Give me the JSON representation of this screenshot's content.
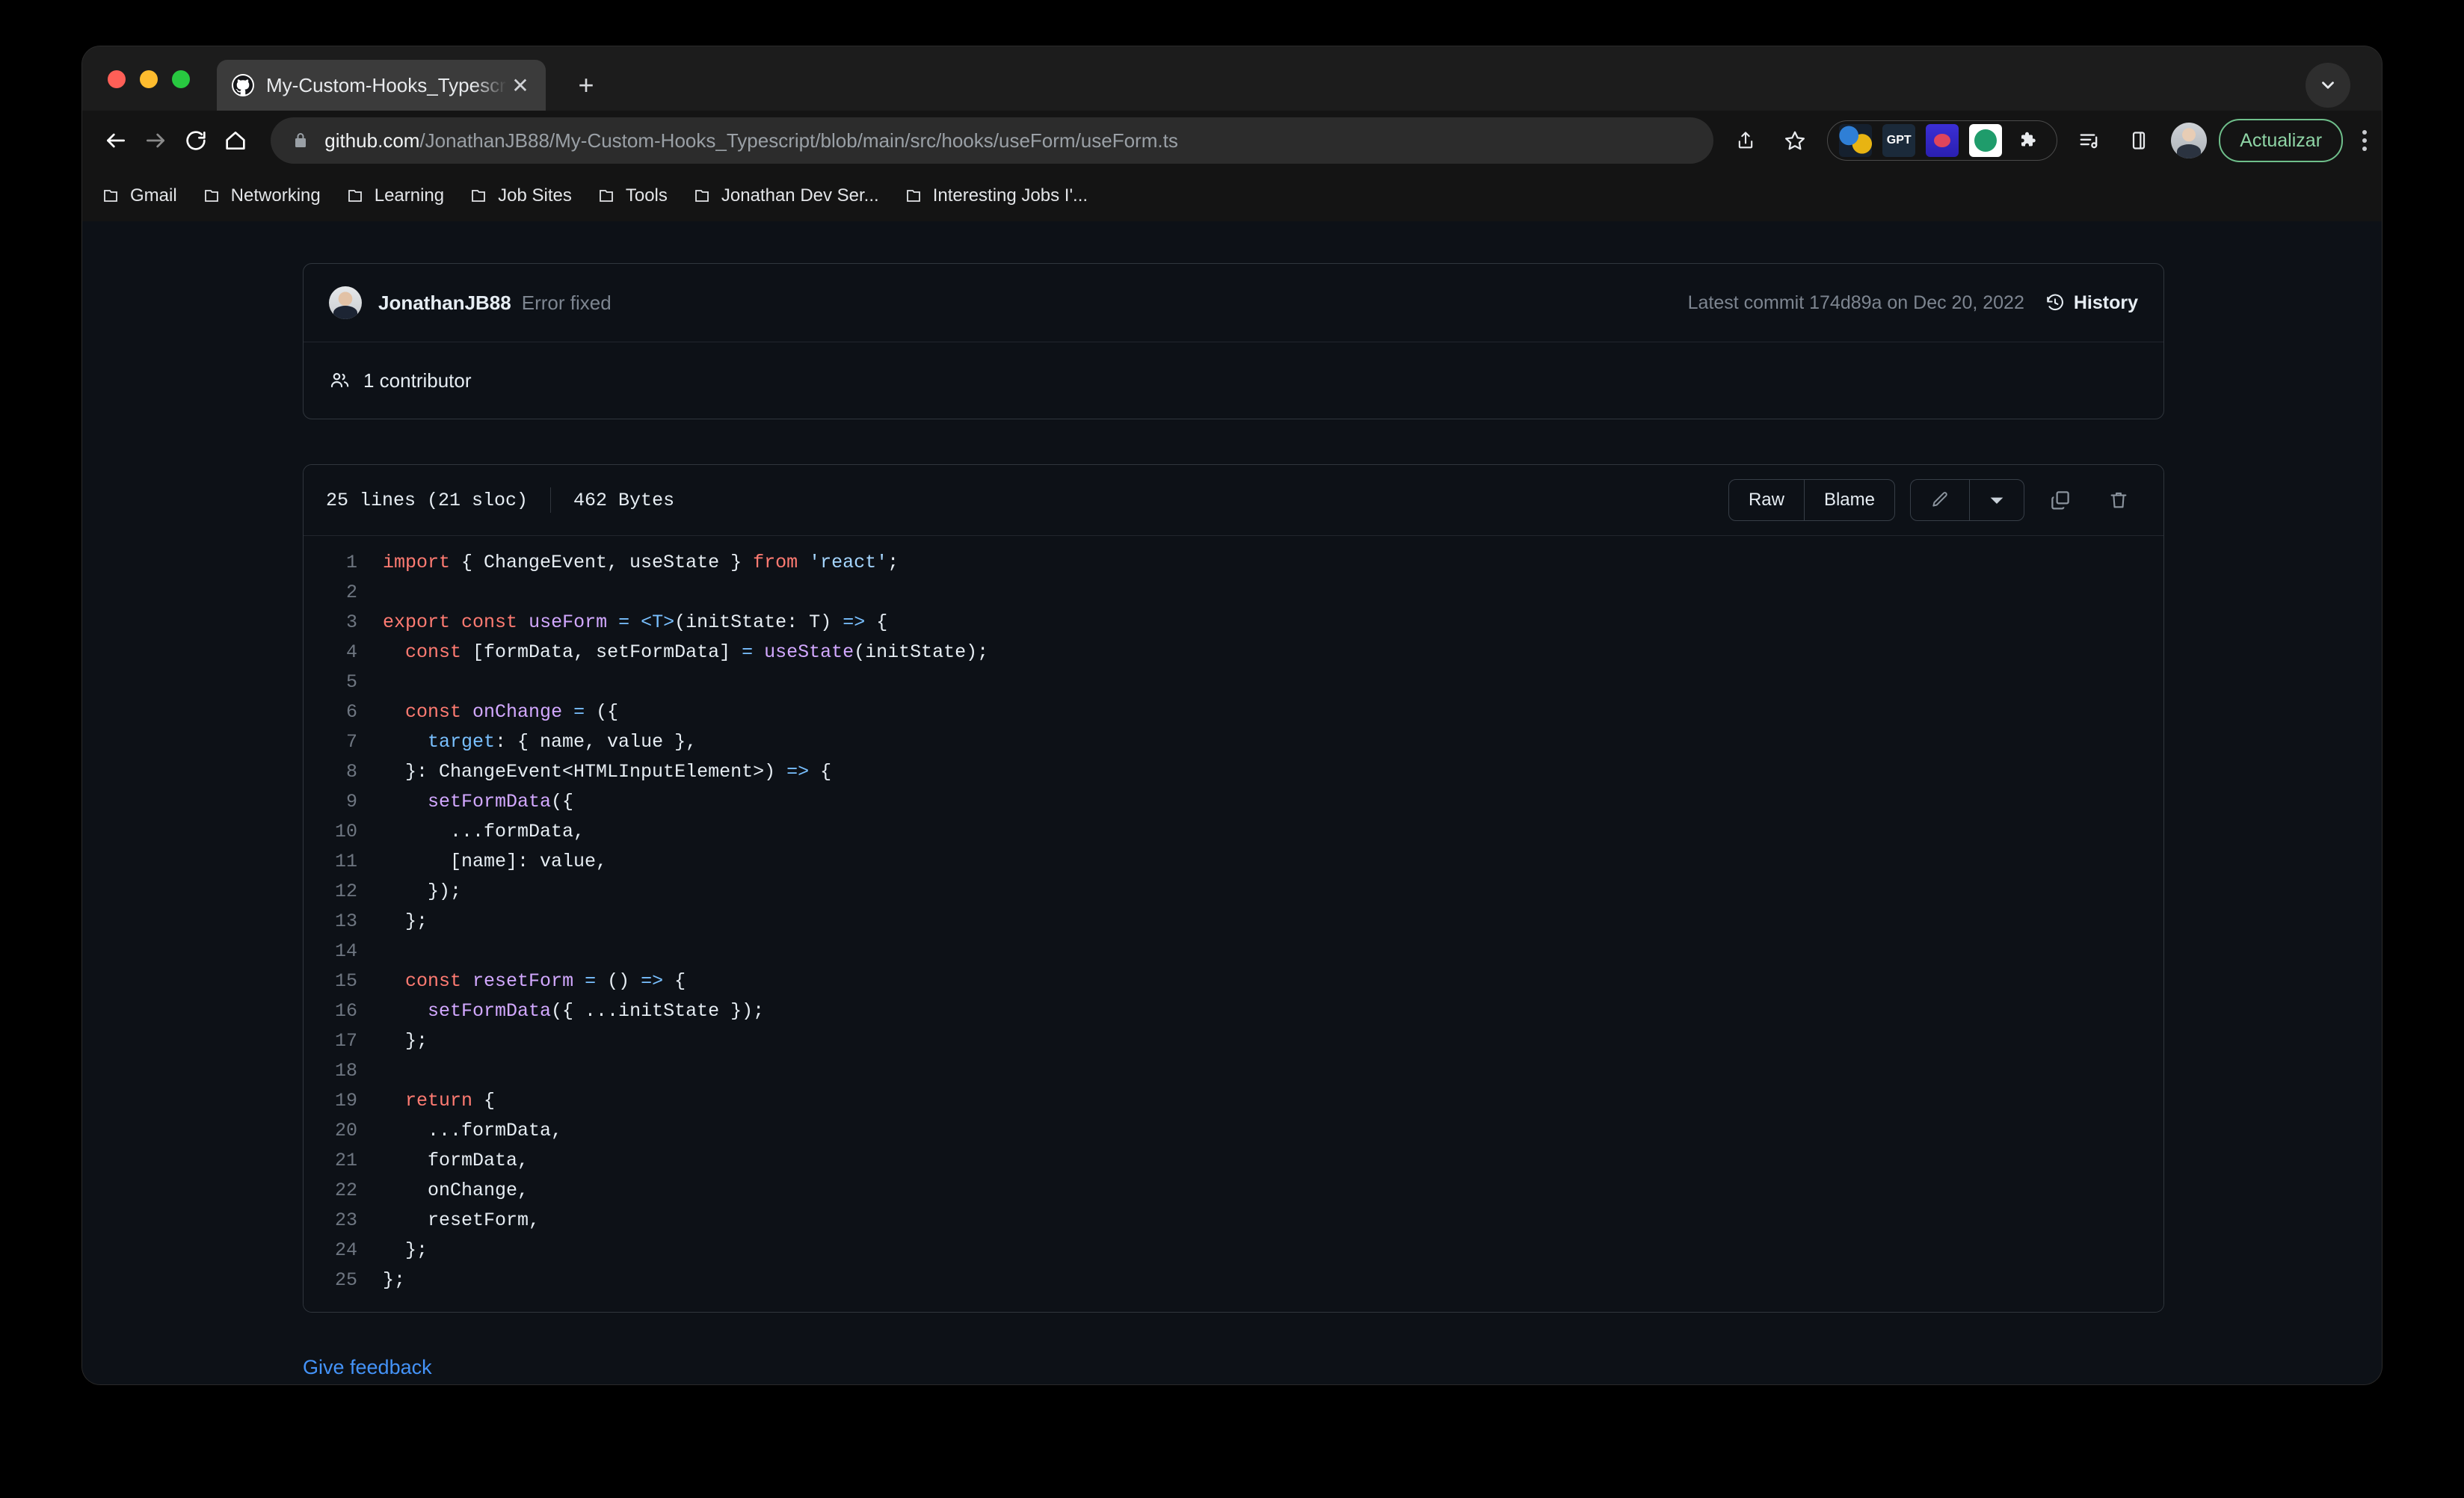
{
  "browser": {
    "tab": {
      "title": "My-Custom-Hooks_Typescript",
      "favicon_icon": "github-icon",
      "close_icon": "close-icon"
    },
    "new_tab_icon": "plus-icon",
    "tab_list_icon": "chevron-down-icon",
    "nav": {
      "back_icon": "arrow-left-icon",
      "forward_icon": "arrow-right-icon",
      "reload_icon": "reload-icon",
      "home_icon": "home-icon"
    },
    "omnibox": {
      "lock_icon": "lock-icon",
      "url_domain": "github.com",
      "url_path": "/JonathanJB88/My-Custom-Hooks_Typescript/blob/main/src/hooks/useForm/useForm.ts"
    },
    "toolbar_icons": [
      {
        "name": "share-icon",
        "label": ""
      },
      {
        "name": "bookmark-star-icon",
        "label": ""
      }
    ],
    "extensions": [
      {
        "name": "colorful-extension-icon",
        "label": ""
      },
      {
        "name": "gpt-extension-icon",
        "label": "GPT"
      },
      {
        "name": "brain-extension-icon",
        "label": ""
      },
      {
        "name": "green-extension-icon",
        "label": ""
      },
      {
        "name": "puzzle-extensions-icon",
        "label": ""
      }
    ],
    "right_icons": [
      {
        "name": "reading-list-icon"
      },
      {
        "name": "side-panel-icon"
      }
    ],
    "profile_icon": "profile-avatar",
    "update_button": "Actualizar",
    "menu_icon": "kebab-menu-icon",
    "bookmarks": [
      {
        "label": "Gmail",
        "icon": "folder-icon"
      },
      {
        "label": "Networking",
        "icon": "folder-icon"
      },
      {
        "label": "Learning",
        "icon": "folder-icon"
      },
      {
        "label": "Job Sites",
        "icon": "folder-icon"
      },
      {
        "label": "Tools",
        "icon": "folder-icon"
      },
      {
        "label": "Jonathan Dev Ser...",
        "icon": "folder-icon"
      },
      {
        "label": "Interesting Jobs I'...",
        "icon": "folder-icon"
      }
    ]
  },
  "page": {
    "commit": {
      "author": "JonathanJB88",
      "message": "Error fixed",
      "meta": "Latest commit 174d89a on Dec 20, 2022",
      "history_label": "History",
      "history_icon": "history-clock-icon",
      "avatar_icon": "user-avatar"
    },
    "contributors": {
      "icon": "people-icon",
      "count": "1",
      "label": "contributor",
      "full": "1 contributor"
    },
    "file": {
      "lines_label": "25 lines (21 sloc)",
      "size_label": "462 Bytes",
      "raw_label": "Raw",
      "blame_label": "Blame",
      "edit_icon": "pencil-icon",
      "edit_dropdown_icon": "chevron-down-icon",
      "copy_icon": "copy-icon",
      "delete_icon": "trash-icon"
    },
    "feedback_link": "Give feedback",
    "code_lines": [
      {
        "n": "1",
        "tokens": [
          [
            "kw",
            "import"
          ],
          [
            "pl",
            " { ChangeEvent, useState } "
          ],
          [
            "kw",
            "from"
          ],
          [
            "pl",
            " "
          ],
          [
            "str",
            "'react'"
          ],
          [
            "pl",
            ";"
          ]
        ]
      },
      {
        "n": "2",
        "tokens": []
      },
      {
        "n": "3",
        "tokens": [
          [
            "kw",
            "export"
          ],
          [
            "pl",
            " "
          ],
          [
            "kw",
            "const"
          ],
          [
            "pl",
            " "
          ],
          [
            "fn",
            "useForm"
          ],
          [
            "pl",
            " "
          ],
          [
            "op",
            "="
          ],
          [
            "pl",
            " "
          ],
          [
            "op",
            "<T>"
          ],
          [
            "pl",
            "(initState: T) "
          ],
          [
            "op",
            "=>"
          ],
          [
            "pl",
            " {"
          ]
        ]
      },
      {
        "n": "4",
        "tokens": [
          [
            "pl",
            "  "
          ],
          [
            "kw",
            "const"
          ],
          [
            "pl",
            " [formData, setFormData] "
          ],
          [
            "op",
            "="
          ],
          [
            "pl",
            " "
          ],
          [
            "fn",
            "useState"
          ],
          [
            "pl",
            "(initState);"
          ]
        ]
      },
      {
        "n": "5",
        "tokens": []
      },
      {
        "n": "6",
        "tokens": [
          [
            "pl",
            "  "
          ],
          [
            "kw",
            "const"
          ],
          [
            "pl",
            " "
          ],
          [
            "fn",
            "onChange"
          ],
          [
            "pl",
            " "
          ],
          [
            "op",
            "="
          ],
          [
            "pl",
            " ({"
          ]
        ]
      },
      {
        "n": "7",
        "tokens": [
          [
            "pl",
            "    "
          ],
          [
            "op",
            "target"
          ],
          [
            "pl",
            ": { name, value },"
          ]
        ]
      },
      {
        "n": "8",
        "tokens": [
          [
            "pl",
            "  }: ChangeEvent<HTMLInputElement>) "
          ],
          [
            "op",
            "=>"
          ],
          [
            "pl",
            " {"
          ]
        ]
      },
      {
        "n": "9",
        "tokens": [
          [
            "pl",
            "    "
          ],
          [
            "fn",
            "setFormData"
          ],
          [
            "pl",
            "({"
          ]
        ]
      },
      {
        "n": "10",
        "tokens": [
          [
            "pl",
            "      ...formData,"
          ]
        ]
      },
      {
        "n": "11",
        "tokens": [
          [
            "pl",
            "      [name]: value,"
          ]
        ]
      },
      {
        "n": "12",
        "tokens": [
          [
            "pl",
            "    });"
          ]
        ]
      },
      {
        "n": "13",
        "tokens": [
          [
            "pl",
            "  };"
          ]
        ]
      },
      {
        "n": "14",
        "tokens": []
      },
      {
        "n": "15",
        "tokens": [
          [
            "pl",
            "  "
          ],
          [
            "kw",
            "const"
          ],
          [
            "pl",
            " "
          ],
          [
            "fn",
            "resetForm"
          ],
          [
            "pl",
            " "
          ],
          [
            "op",
            "="
          ],
          [
            "pl",
            " () "
          ],
          [
            "op",
            "=>"
          ],
          [
            "pl",
            " {"
          ]
        ]
      },
      {
        "n": "16",
        "tokens": [
          [
            "pl",
            "    "
          ],
          [
            "fn",
            "setFormData"
          ],
          [
            "pl",
            "({ ...initState });"
          ]
        ]
      },
      {
        "n": "17",
        "tokens": [
          [
            "pl",
            "  };"
          ]
        ]
      },
      {
        "n": "18",
        "tokens": []
      },
      {
        "n": "19",
        "tokens": [
          [
            "pl",
            "  "
          ],
          [
            "kw",
            "return"
          ],
          [
            "pl",
            " {"
          ]
        ]
      },
      {
        "n": "20",
        "tokens": [
          [
            "pl",
            "    ...formData,"
          ]
        ]
      },
      {
        "n": "21",
        "tokens": [
          [
            "pl",
            "    formData,"
          ]
        ]
      },
      {
        "n": "22",
        "tokens": [
          [
            "pl",
            "    onChange,"
          ]
        ]
      },
      {
        "n": "23",
        "tokens": [
          [
            "pl",
            "    resetForm,"
          ]
        ]
      },
      {
        "n": "24",
        "tokens": [
          [
            "pl",
            "  };"
          ]
        ]
      },
      {
        "n": "25",
        "tokens": [
          [
            "pl",
            "};"
          ]
        ]
      }
    ]
  },
  "colors": {
    "page_bg": "#0d1117",
    "border": "#30363d",
    "link": "#4493f8",
    "keyword": "#ff7b72",
    "function": "#d2a8ff",
    "string": "#a5d6ff",
    "operator": "#79c0ff",
    "plain": "#e6edf3",
    "muted": "#7d8590",
    "update_accent": "#8fd5a6"
  }
}
